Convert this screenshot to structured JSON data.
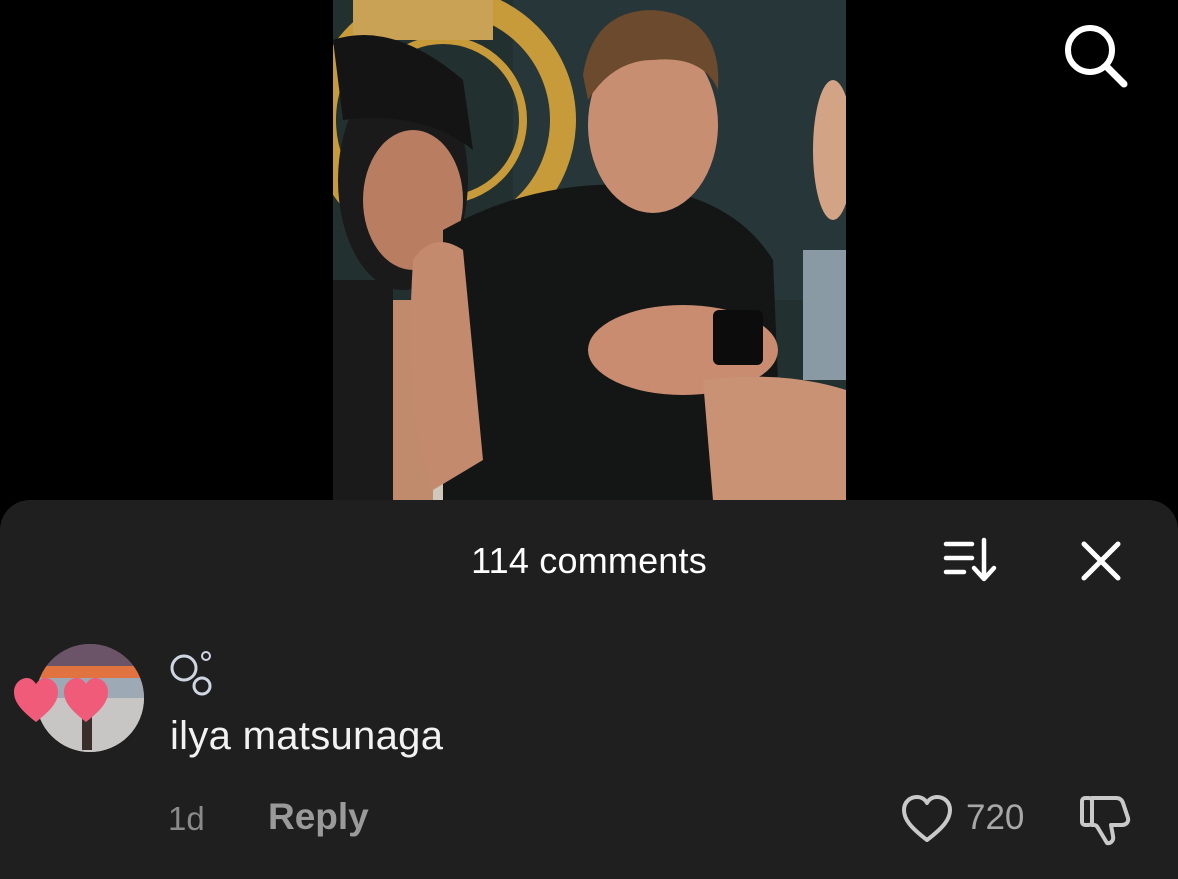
{
  "video": {
    "icons": {
      "search": "search-icon"
    }
  },
  "comments_sheet": {
    "count_label": "114 comments",
    "icons": {
      "sort": "sort-icon",
      "close": "close-icon"
    },
    "comments": [
      {
        "username": "ilya matsunaga",
        "badge_icon": "bubbles-icon",
        "time": "1d",
        "reply_label": "Reply",
        "likes": "720",
        "icons": {
          "like": "heart-icon",
          "dislike": "thumbs-down-icon"
        }
      }
    ]
  },
  "colors": {
    "sheet_background": "#1f1f1f",
    "secondary_text": "#8a8a8a",
    "avatar_hearts": "#ef5b78"
  }
}
